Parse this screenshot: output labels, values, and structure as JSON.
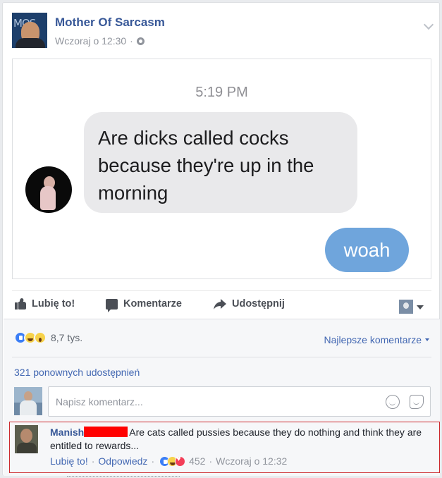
{
  "post": {
    "page_name": "Mother Of Sarcasm",
    "page_avatar_text": "MOS",
    "timestamp": "Wczoraj o 12:30",
    "separator": "·"
  },
  "image": {
    "message_time": "5:19 PM",
    "received_message": "Are dicks called cocks because they're up in the morning",
    "sent_message": "woah"
  },
  "actions": {
    "like_label": "Lubię to!",
    "comment_label": "Komentarze",
    "share_label": "Udostępnij"
  },
  "stats": {
    "reaction_count": "8,7 tys.",
    "sort_label": "Najlepsze komentarze",
    "shares_text": "321 ponownych udostępnień"
  },
  "composer": {
    "placeholder": "Napisz komentarz..."
  },
  "comment": {
    "author": "Manish",
    "text": "Are cats called pussies because they do nothing and think they are entitled to rewards...",
    "like_label": "Lubię to!",
    "reply_label": "Odpowiedz",
    "reaction_count": "452",
    "timestamp": "Wczoraj o 12:32",
    "separator": "·"
  },
  "colors": {
    "link_blue": "#385898",
    "bubble_gray": "#e9e9eb",
    "bubble_blue": "#6fa5dc",
    "highlight_border": "#cc2a2e",
    "redaction": "#ff0000"
  }
}
